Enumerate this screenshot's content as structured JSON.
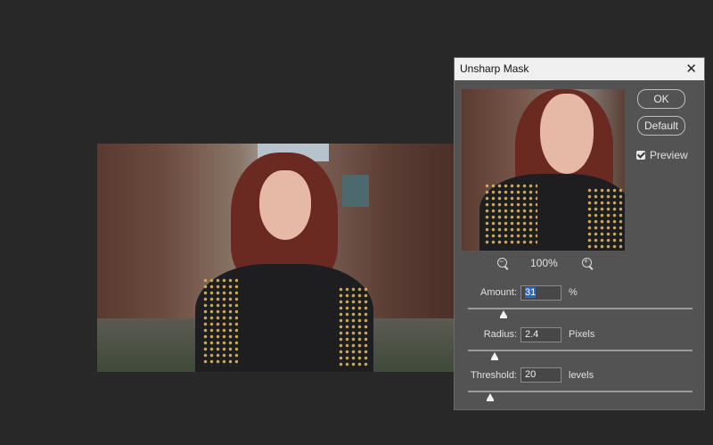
{
  "dialog": {
    "title": "Unsharp Mask",
    "close_icon": "close-icon",
    "ok_label": "OK",
    "default_label": "Default",
    "preview_label": "Preview",
    "preview_checked": true,
    "zoom_level": "100%",
    "zoom_out_icon": "zoom-out-icon",
    "zoom_in_icon": "zoom-in-icon",
    "amount": {
      "label": "Amount:",
      "value": "31",
      "unit": "%",
      "slider_fraction": 0.16
    },
    "radius": {
      "label": "Radius:",
      "value": "2.4",
      "unit": "Pixels",
      "slider_fraction": 0.12
    },
    "threshold": {
      "label": "Threshold:",
      "value": "20",
      "unit": "levels",
      "slider_fraction": 0.1
    }
  },
  "colors": {
    "dialog_bg": "#535353",
    "workspace_bg": "#282828",
    "titlebar_bg": "#f0f0f0",
    "selection": "#2a68c8"
  }
}
